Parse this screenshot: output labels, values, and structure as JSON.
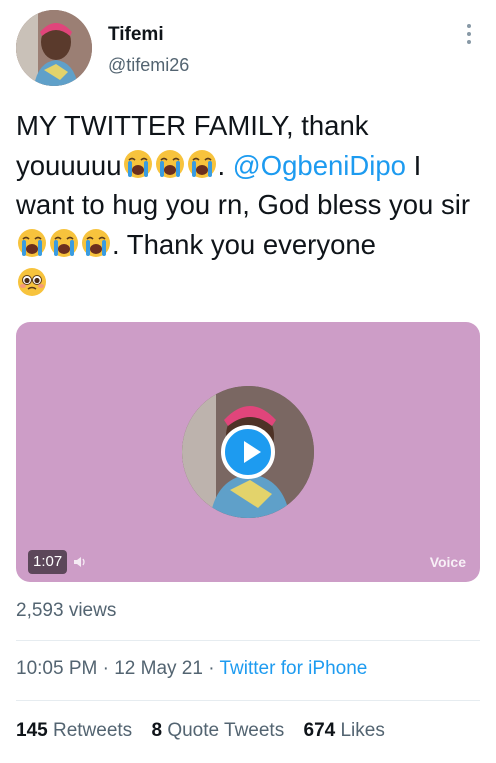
{
  "user": {
    "display_name": "Tifemi",
    "handle": "@tifemi26"
  },
  "tweet": {
    "line1": "MY TWITTER FAMILY, thank",
    "part2": "youuuuu",
    "part3": ". ",
    "mention": "@OgbeniDipo",
    "part4": " I want to hug you rn, God bless you sir",
    "part5": ". Thank you everyone",
    "emojis": [
      "crying-face",
      "pleading-face"
    ]
  },
  "media": {
    "duration": "1:07",
    "label": "Voice",
    "background": "#cd9dc7"
  },
  "views": "2,593 views",
  "meta": {
    "time": "10:05 PM",
    "sep": " · ",
    "date": "12 May 21",
    "source": "Twitter for iPhone"
  },
  "stats": {
    "retweets_count": "145",
    "retweets_label": "Retweets",
    "quotes_count": "8",
    "quotes_label": "Quote Tweets",
    "likes_count": "674",
    "likes_label": "Likes"
  },
  "colors": {
    "accent": "#1d9bf0",
    "text": "#0f1419",
    "secondary": "#536471"
  }
}
